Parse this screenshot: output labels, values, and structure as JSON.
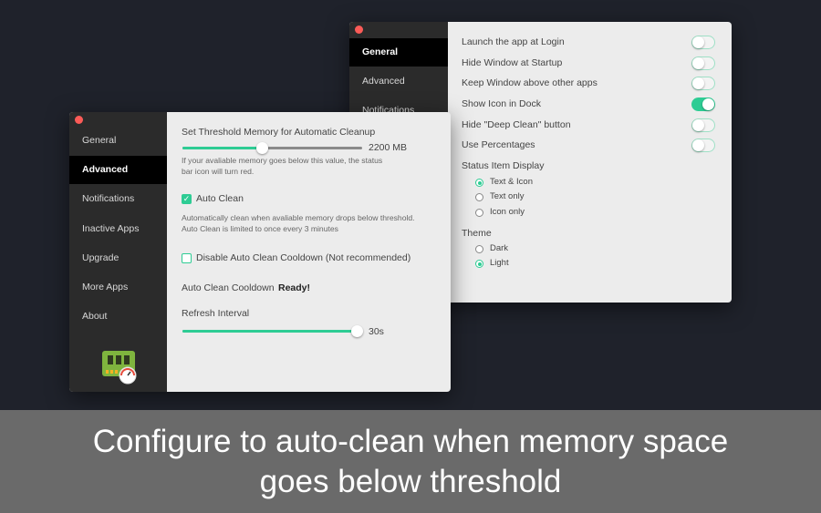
{
  "back_window": {
    "sidebar": [
      {
        "label": "General",
        "selected": true
      },
      {
        "label": "Advanced"
      },
      {
        "label": "Notifications"
      }
    ],
    "toggles": [
      {
        "label": "Launch the app at Login",
        "on": false
      },
      {
        "label": "Hide Window at Startup",
        "on": false
      },
      {
        "label": "Keep Window above other apps",
        "on": false
      },
      {
        "label": "Show Icon in Dock",
        "on": true
      },
      {
        "label": "Hide \"Deep Clean\" button",
        "on": false
      },
      {
        "label": "Use Percentages",
        "on": false
      }
    ],
    "status_item_display": {
      "label": "Status Item Display",
      "options": [
        "Text & Icon",
        "Text only",
        "Icon only"
      ],
      "selected": "Text & Icon"
    },
    "theme": {
      "label": "Theme",
      "options": [
        "Dark",
        "Light"
      ],
      "selected": "Light"
    }
  },
  "front_window": {
    "sidebar": [
      {
        "label": "General"
      },
      {
        "label": "Advanced",
        "selected": true
      },
      {
        "label": "Notifications"
      },
      {
        "label": "Inactive Apps"
      },
      {
        "label": "Upgrade"
      },
      {
        "label": "More Apps"
      },
      {
        "label": "About"
      }
    ],
    "app_icon": "ram-chip-gauge-icon",
    "threshold": {
      "label": "Set Threshold Memory for Automatic Cleanup",
      "value": "2200 MB",
      "fraction": 0.44,
      "help": "If your avaliable memory goes below this value, the status bar icon will turn red."
    },
    "auto_clean": {
      "label": "Auto Clean",
      "checked": true,
      "help1": "Automatically clean when avaliable memory drops below threshold.",
      "help2": "Auto Clean is limited to once every 3 minutes"
    },
    "disable_cooldown": {
      "label": "Disable Auto Clean Cooldown (Not recommended)",
      "checked": false
    },
    "cooldown": {
      "label": "Auto Clean Cooldown",
      "status": "Ready!"
    },
    "refresh": {
      "label": "Refresh Interval",
      "value": "30s",
      "fraction": 0.97
    }
  },
  "caption": {
    "line1": "Configure to auto-clean when memory space",
    "line2": "goes below threshold"
  },
  "colors": {
    "accent": "#2ecc94",
    "background": "#1f222b",
    "caption_band": "#6a6a6a"
  }
}
